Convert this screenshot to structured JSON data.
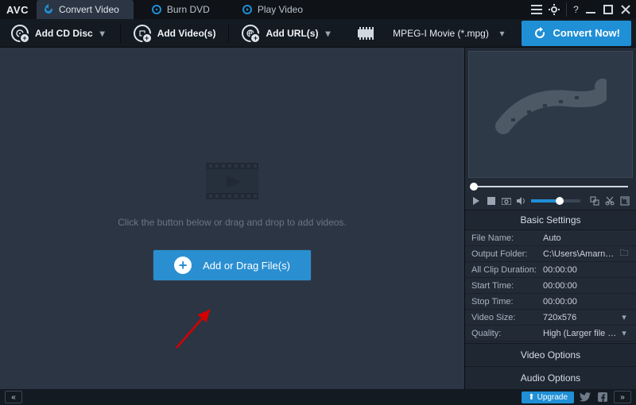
{
  "app": {
    "logo": "AVC"
  },
  "tabs": [
    {
      "label": "Convert Video",
      "active": true
    },
    {
      "label": "Burn DVD",
      "active": false
    },
    {
      "label": "Play Video",
      "active": false
    }
  ],
  "toolbar": {
    "add_cd": "Add CD Disc",
    "add_videos": "Add Video(s)",
    "add_urls": "Add URL(s)",
    "profile_label": "MPEG-I Movie (*.mpg)",
    "convert_label": "Convert Now!"
  },
  "stage": {
    "hint": "Click the button below or drag and drop to add videos.",
    "add_button": "Add or Drag File(s)"
  },
  "settings": {
    "section_title": "Basic Settings",
    "rows": {
      "file_name": {
        "k": "File Name:",
        "v": "Auto"
      },
      "output_folder": {
        "k": "Output Folder:",
        "v": "C:\\Users\\Amarnath\\On..."
      },
      "all_clip_duration": {
        "k": "All Clip Duration:",
        "v": "00:00:00"
      },
      "start_time": {
        "k": "Start Time:",
        "v": "00:00:00"
      },
      "stop_time": {
        "k": "Stop Time:",
        "v": "00:00:00"
      },
      "video_size": {
        "k": "Video Size:",
        "v": "720x576"
      },
      "quality": {
        "k": "Quality:",
        "v": "High (Larger file size)"
      }
    },
    "video_options": "Video Options",
    "audio_options": "Audio Options"
  },
  "bottom": {
    "upgrade": "Upgrade"
  }
}
